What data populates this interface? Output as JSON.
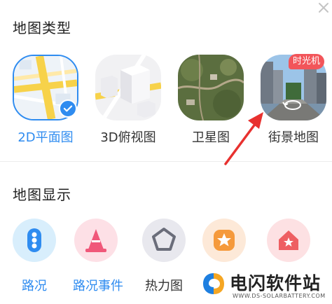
{
  "header": {
    "close_icon": "close-icon"
  },
  "map_type": {
    "title": "地图类型",
    "options": [
      {
        "label": "2D平面图",
        "selected": true
      },
      {
        "label": "3D俯视图",
        "selected": false
      },
      {
        "label": "卫星图",
        "selected": false
      },
      {
        "label": "街景地图",
        "selected": false,
        "badge": "时光机"
      }
    ]
  },
  "map_display": {
    "title": "地图显示",
    "items": [
      {
        "label": "路况",
        "icon": "traffic-light-icon"
      },
      {
        "label": "路况事件",
        "icon": "traffic-cone-icon"
      },
      {
        "label": "热力图",
        "icon": "pentagon-icon"
      },
      {
        "label": "",
        "icon": "star-icon"
      },
      {
        "label": "",
        "icon": "home-star-icon"
      }
    ]
  },
  "watermark": {
    "text": "电闪软件站",
    "sub": "WWW.DS-SOLARBATTERY.COM"
  },
  "colors": {
    "accent": "#2f8cf0",
    "annotation_arrow": "#e8312f",
    "badge": "#f2555a"
  }
}
